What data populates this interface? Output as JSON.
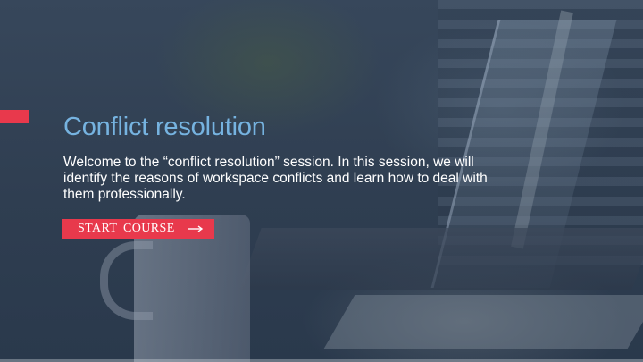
{
  "slide": {
    "title": "Conflict resolution",
    "description": "Welcome to the “conflict resolution” session. In this session, we will identify the reasons of workspace conflicts and learn how to deal with them professionally.",
    "start_button": {
      "label": "START  COURSE",
      "icon": "arrow-right-icon"
    }
  },
  "colors": {
    "accent": "#e8394c",
    "title": "#76b3e0",
    "overlay": "#2f3e51",
    "text": "#ffffff"
  }
}
